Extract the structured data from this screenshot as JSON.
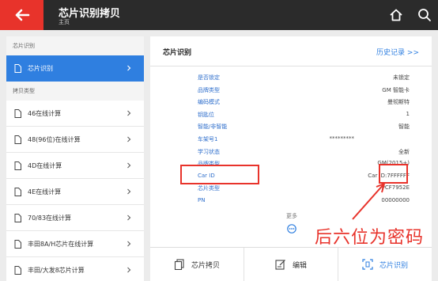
{
  "header": {
    "title": "芯片识别拷贝",
    "subtitle": "主页"
  },
  "sidebar": {
    "section1": "芯片识别",
    "active_item": "芯片识别",
    "section2": "拷贝类型",
    "items": [
      "46在线计算",
      "48(96位)在线计算",
      "4D在线计算",
      "4E在线计算",
      "70/83在线计算",
      "丰田8A/H芯片在线计算",
      "丰田/大发8芯片计算"
    ]
  },
  "main": {
    "title": "芯片识别",
    "history_link": "历史记录 >>",
    "rows": [
      {
        "key": "是否锁定",
        "value": "未锁定"
      },
      {
        "key": "品牌类型",
        "value": "GM 智能卡"
      },
      {
        "key": "编码模式",
        "value": "曼彻斯特"
      },
      {
        "key": "钥匙位",
        "value": "1"
      },
      {
        "key": "智能/非智能",
        "value": "智能"
      },
      {
        "key": "车架号1",
        "value": "*********"
      },
      {
        "key": "学习状态",
        "value": "全新"
      },
      {
        "key": "品牌类型",
        "value": "GM(2015+)"
      },
      {
        "key": "Car ID",
        "value": "Car ID:7FFFFFF"
      },
      {
        "key": "芯片类型",
        "value": "PCF7952E"
      },
      {
        "key": "PN",
        "value": "00000000"
      }
    ],
    "more_label": "更多"
  },
  "bottom_bar": {
    "copy_label": "芯片拷贝",
    "edit_label": "编辑",
    "identify_label": "芯片识别"
  },
  "annotation": {
    "text": "后六位为密码"
  },
  "colors": {
    "accent_red": "#e8332b",
    "accent_blue": "#2f7fe0",
    "topbar": "#2b2b2b"
  }
}
